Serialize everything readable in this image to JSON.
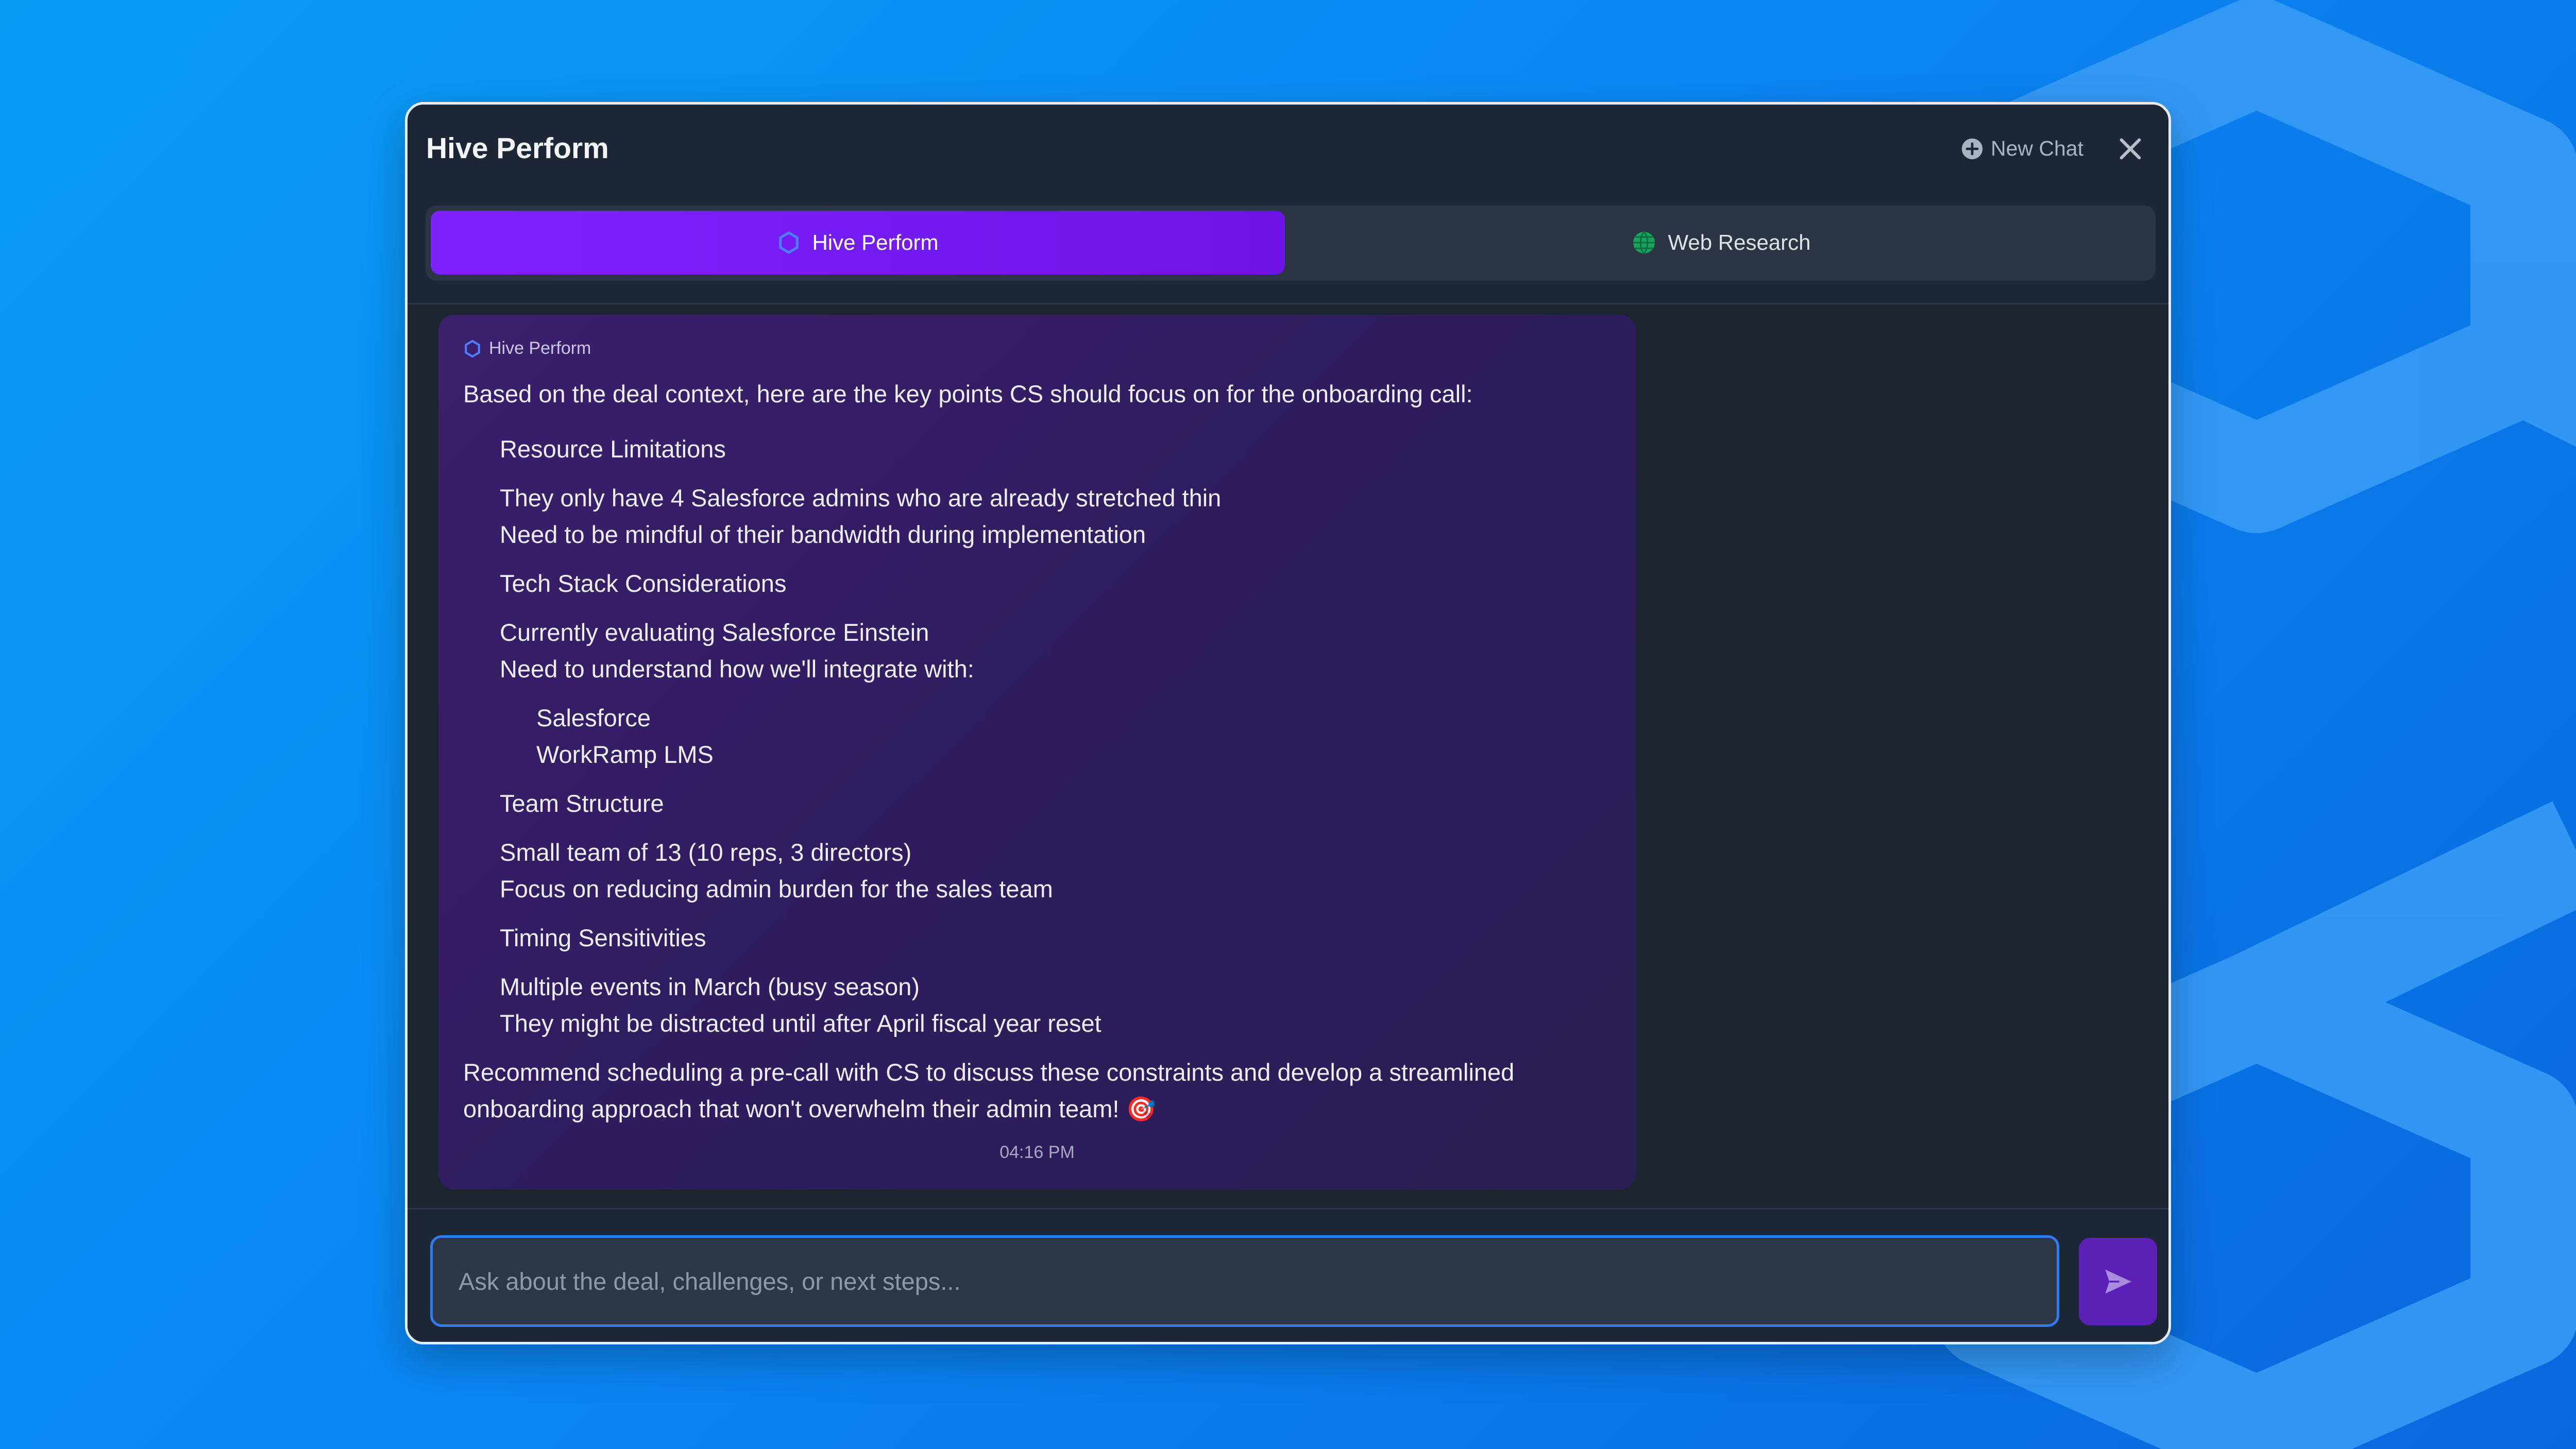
{
  "window": {
    "title": "Hive Perform",
    "new_chat_label": "New Chat",
    "close_icon": "close-icon",
    "new_chat_icon": "plus-circle-icon"
  },
  "tabs": [
    {
      "label": "Hive Perform",
      "icon": "hexagon-icon",
      "active": true
    },
    {
      "label": "Web Research",
      "icon": "globe-icon",
      "active": false
    }
  ],
  "message": {
    "sender": "Hive Perform",
    "lines": [
      "Based on the deal context, here are the key points CS should focus on for the onboarding call:",
      "Resource Limitations",
      "They only have 4 Salesforce admins who are already stretched thin",
      "Need to be mindful of their bandwidth during implementation",
      "Tech Stack Considerations",
      "Currently evaluating Salesforce Einstein",
      "Need to understand how we'll integrate with:",
      "Salesforce",
      "WorkRamp LMS",
      "Team Structure",
      "Small team of 13 (10 reps, 3 directors)",
      "Focus on reducing admin burden for the sales team",
      "Timing Sensitivities",
      "Multiple events in March (busy season)",
      "They might be distracted until after April fiscal year reset",
      "Recommend scheduling a pre-call with CS to discuss these constraints and develop a streamlined",
      "onboarding approach that won't overwhelm their admin team! 🎯"
    ],
    "time": "04:16 PM"
  },
  "composer": {
    "placeholder": "Ask about the deal, challenges, or next steps...",
    "value": "",
    "send_icon": "send-icon"
  },
  "colors": {
    "background": "#0a86f2",
    "window": "#1d2634",
    "accent": "#7c22ff",
    "input_border": "#2f7bf0",
    "send_button": "#5b21b6"
  }
}
